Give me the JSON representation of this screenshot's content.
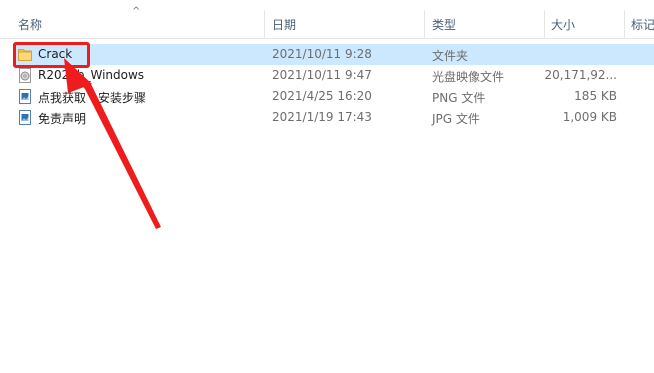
{
  "columns": {
    "name": "名称",
    "date": "日期",
    "type": "类型",
    "size": "大小",
    "tags": "标记"
  },
  "sort_indicator": "^",
  "files": [
    {
      "name": "Crack",
      "date": "2021/10/11 9:28",
      "type": "文件夹",
      "size": "",
      "icon": "folder-icon",
      "selected": true
    },
    {
      "name": "R2021b_Windows",
      "date": "2021/10/11 9:47",
      "type": "光盘映像文件",
      "size": "20,171,92...",
      "icon": "disc-image-icon",
      "selected": false
    },
    {
      "name": "点我获取 - 安装步骤",
      "date": "2021/4/25 16:20",
      "type": "PNG 文件",
      "size": "185 KB",
      "icon": "image-file-icon",
      "selected": false
    },
    {
      "name": "免责声明",
      "date": "2021/1/19 17:43",
      "type": "JPG 文件",
      "size": "1,009 KB",
      "icon": "image-file-icon",
      "selected": false
    }
  ],
  "annotation": {
    "color": "#ee1c1c"
  }
}
